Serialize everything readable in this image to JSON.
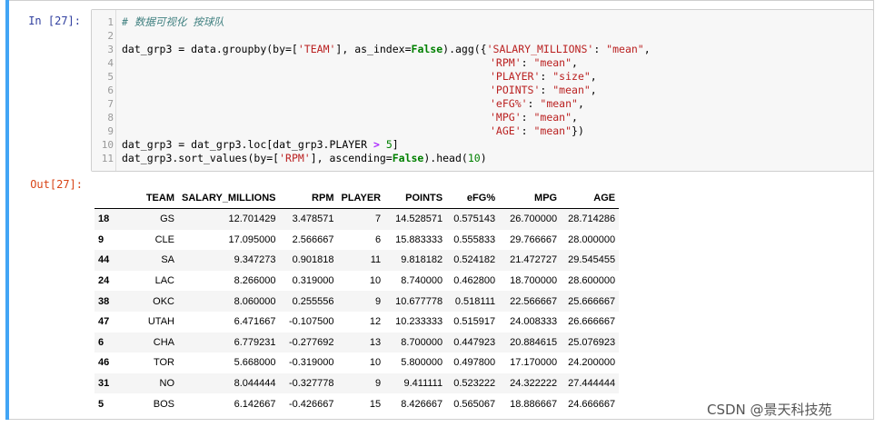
{
  "input_prompt": "In  [27]:",
  "output_prompt": "Out[27]:",
  "code_line_numbers": [
    "1",
    "2",
    "3",
    "4",
    "5",
    "6",
    "7",
    "8",
    "9",
    "10",
    "11"
  ],
  "code": {
    "l1": "# 数据可视化 按球队",
    "l3a": "dat_grp3 = data.groupby(by=[",
    "l3b": "'TEAM'",
    "l3c": "], as_index=",
    "l3d": "False",
    "l3e": ").agg({",
    "l3f": "'SALARY_MILLIONS'",
    "l3g": ": ",
    "l3h": "\"mean\"",
    "l3i": ",",
    "l4k": "'RPM'",
    "l4v": "\"mean\"",
    "l5k": "'PLAYER'",
    "l5v": "\"size\"",
    "l6k": "'POINTS'",
    "l6v": "\"mean\"",
    "l7k": "'eFG%'",
    "l7v": "\"mean\"",
    "l8k": "'MPG'",
    "l8v": "\"mean\"",
    "l9k": "'AGE'",
    "l9v": "\"mean\"",
    "l9e": "})",
    "l10a": "dat_grp3 = dat_grp3.loc[dat_grp3.PLAYER ",
    "l10b": ">",
    "l10c": " ",
    "l10d": "5",
    "l10e": "]",
    "l11a": "dat_grp3.sort_values(by=[",
    "l11b": "'RPM'",
    "l11c": "], ascending=",
    "l11d": "False",
    "l11e": ").head(",
    "l11f": "10",
    "l11g": ")",
    "colon_sep": ": ",
    "comma": ","
  },
  "table": {
    "columns": [
      "TEAM",
      "SALARY_MILLIONS",
      "RPM",
      "PLAYER",
      "POINTS",
      "eFG%",
      "MPG",
      "AGE"
    ],
    "rows": [
      {
        "index": "18",
        "cells": [
          "GS",
          "12.701429",
          "3.478571",
          "7",
          "14.528571",
          "0.575143",
          "26.700000",
          "28.714286"
        ]
      },
      {
        "index": "9",
        "cells": [
          "CLE",
          "17.095000",
          "2.566667",
          "6",
          "15.883333",
          "0.555833",
          "29.766667",
          "28.000000"
        ]
      },
      {
        "index": "44",
        "cells": [
          "SA",
          "9.347273",
          "0.901818",
          "11",
          "9.818182",
          "0.524182",
          "21.472727",
          "29.545455"
        ]
      },
      {
        "index": "24",
        "cells": [
          "LAC",
          "8.266000",
          "0.319000",
          "10",
          "8.740000",
          "0.462800",
          "18.700000",
          "28.600000"
        ]
      },
      {
        "index": "38",
        "cells": [
          "OKC",
          "8.060000",
          "0.255556",
          "9",
          "10.677778",
          "0.518111",
          "22.566667",
          "25.666667"
        ]
      },
      {
        "index": "47",
        "cells": [
          "UTAH",
          "6.471667",
          "-0.107500",
          "12",
          "10.233333",
          "0.515917",
          "24.008333",
          "26.666667"
        ]
      },
      {
        "index": "6",
        "cells": [
          "CHA",
          "6.779231",
          "-0.277692",
          "13",
          "8.700000",
          "0.447923",
          "20.884615",
          "25.076923"
        ]
      },
      {
        "index": "46",
        "cells": [
          "TOR",
          "5.668000",
          "-0.319000",
          "10",
          "5.800000",
          "0.497800",
          "17.170000",
          "24.200000"
        ]
      },
      {
        "index": "31",
        "cells": [
          "NO",
          "8.044444",
          "-0.327778",
          "9",
          "9.411111",
          "0.523222",
          "24.322222",
          "27.444444"
        ]
      },
      {
        "index": "5",
        "cells": [
          "BOS",
          "6.142667",
          "-0.426667",
          "15",
          "8.426667",
          "0.565067",
          "18.886667",
          "24.666667"
        ]
      }
    ]
  },
  "watermark": "CSDN @景天科技苑",
  "colors": {
    "selection_bar": "#42a5f5",
    "in_prompt": "#303f9f",
    "out_prompt": "#d84315"
  }
}
